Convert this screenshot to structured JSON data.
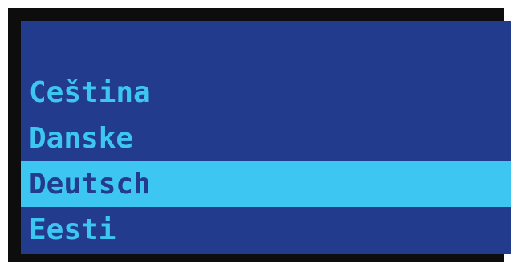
{
  "language_menu": {
    "items": [
      {
        "label": "Ceština",
        "selected": false
      },
      {
        "label": "Danske",
        "selected": false
      },
      {
        "label": "Deutsch",
        "selected": true
      },
      {
        "label": "Eesti",
        "selected": false
      }
    ]
  },
  "colors": {
    "bezel": "#0d0d0d",
    "background": "#233b8c",
    "text": "#3ec6f2",
    "highlight": "#3ec6f2",
    "highlight_text": "#233b8c"
  }
}
